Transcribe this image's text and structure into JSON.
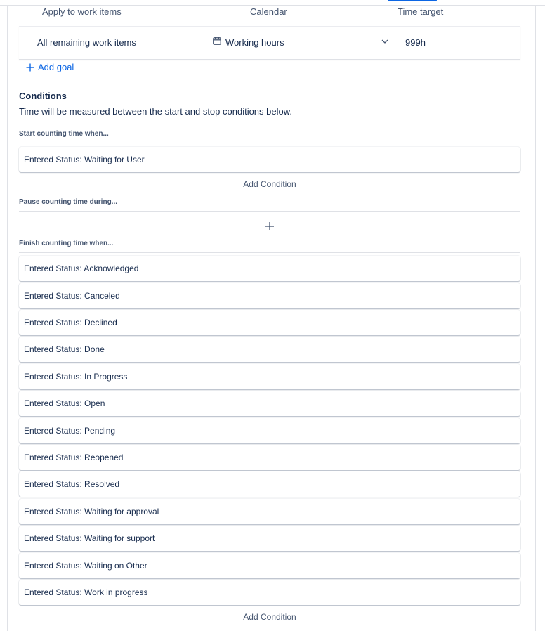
{
  "goal_table": {
    "headers": {
      "apply": "Apply to work items",
      "calendar": "Calendar",
      "target": "Time target"
    },
    "row": {
      "apply": "All remaining work items",
      "calendar": "Working hours",
      "target": "999h"
    },
    "add_goal_label": "Add goal"
  },
  "conditions": {
    "heading": "Conditions",
    "description": "Time will be measured between the start and stop conditions below.",
    "start": {
      "label": "Start counting time when...",
      "items": [
        "Entered Status: Waiting for User"
      ],
      "add_label": "Add Condition"
    },
    "pause": {
      "label": "Pause counting time during..."
    },
    "finish": {
      "label": "Finish counting time when...",
      "items": [
        "Entered Status: Acknowledged",
        "Entered Status: Canceled",
        "Entered Status: Declined",
        "Entered Status: Done",
        "Entered Status: In Progress",
        "Entered Status: Open",
        "Entered Status: Pending",
        "Entered Status: Reopened",
        "Entered Status: Resolved",
        "Entered Status: Waiting for approval",
        "Entered Status: Waiting for support",
        "Entered Status: Waiting on Other",
        "Entered Status: Work in progress"
      ],
      "add_label": "Add Condition"
    }
  },
  "icons": {
    "calendar": "calendar-icon",
    "chevron": "chevron-down-icon",
    "add": "plus-icon"
  },
  "colors": {
    "link": "#0c66e4",
    "text": "#172b4d",
    "subtle": "#44546f"
  }
}
